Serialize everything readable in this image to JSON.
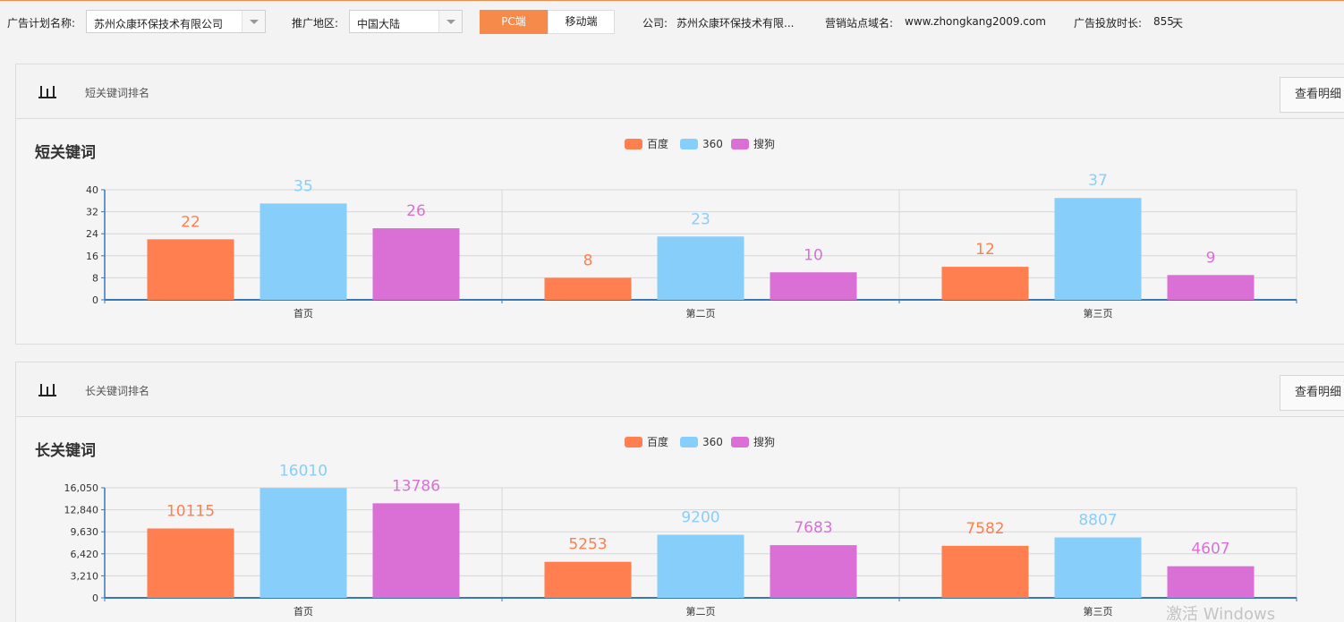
{
  "toolbar": {
    "plan_label": "广告计划名称:",
    "plan_value": "苏州众康环保技术有限公司",
    "region_label": "推广地区:",
    "region_value": "中国大陆",
    "pc_label": "PC端",
    "mobile_label": "移动端",
    "company_label": "公司:",
    "company_value": "苏州众康环保技术有限...",
    "domain_label": "营销站点域名:",
    "domain_value": "www.zhongkang2009.com",
    "duration_label": "广告投放时长:",
    "duration_value": "855",
    "duration_unit": "天"
  },
  "colors": {
    "accent": "#f58a4a",
    "baidu": "#ff7f50",
    "s360": "#87cefa",
    "sogou": "#da70d6"
  },
  "panels": [
    {
      "title": "短关键词排名",
      "detail_button": "查看明细",
      "chart_title": "短关键词"
    },
    {
      "title": "长关键词排名",
      "detail_button": "查看明细",
      "chart_title": "长关键词"
    }
  ],
  "chart_data": [
    {
      "type": "bar",
      "title": "短关键词",
      "categories": [
        "首页",
        "第二页",
        "第三页"
      ],
      "series": [
        {
          "name": "百度",
          "color": "#ff7f50",
          "values": [
            22,
            8,
            12
          ]
        },
        {
          "name": "360",
          "color": "#87cefa",
          "values": [
            35,
            23,
            37
          ]
        },
        {
          "name": "搜狗",
          "color": "#da70d6",
          "values": [
            26,
            10,
            9
          ]
        }
      ],
      "ylim": [
        0,
        40
      ],
      "yticks": [
        "0",
        "8",
        "16",
        "24",
        "32",
        "40"
      ],
      "legend": "top-center",
      "grid": true
    },
    {
      "type": "bar",
      "title": "长关键词",
      "categories": [
        "首页",
        "第二页",
        "第三页"
      ],
      "series": [
        {
          "name": "百度",
          "color": "#ff7f50",
          "values": [
            10115,
            5253,
            7582
          ]
        },
        {
          "name": "360",
          "color": "#87cefa",
          "values": [
            16010,
            9200,
            8807
          ]
        },
        {
          "name": "搜狗",
          "color": "#da70d6",
          "values": [
            13786,
            7683,
            4607
          ]
        }
      ],
      "ylim": [
        0,
        16050
      ],
      "yticks": [
        "0",
        "3,210",
        "6,420",
        "9,630",
        "12,840",
        "16,050"
      ],
      "legend": "top-center",
      "grid": true
    }
  ],
  "watermark": "激活 Windows"
}
